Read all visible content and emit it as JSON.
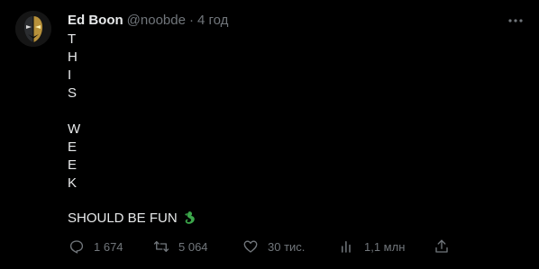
{
  "author": {
    "name": "Ed Boon",
    "handle": "@noobde",
    "separator": "·",
    "timestamp": "4 год"
  },
  "tweet": {
    "vertical_letters": [
      "T",
      "H",
      "I",
      "S",
      "",
      "W",
      "E",
      "E",
      "K"
    ],
    "closing_text": "SHOULD BE FUN",
    "emoji": "dragon-logo-emoji"
  },
  "actions": {
    "reply_count": "1 674",
    "retweet_count": "5 064",
    "like_count": "30 тис.",
    "views_count": "1,1 млн"
  },
  "colors": {
    "background": "#000000",
    "text_primary": "#e7e9ea",
    "text_secondary": "#71767b",
    "emoji_green": "#3ba64a"
  }
}
